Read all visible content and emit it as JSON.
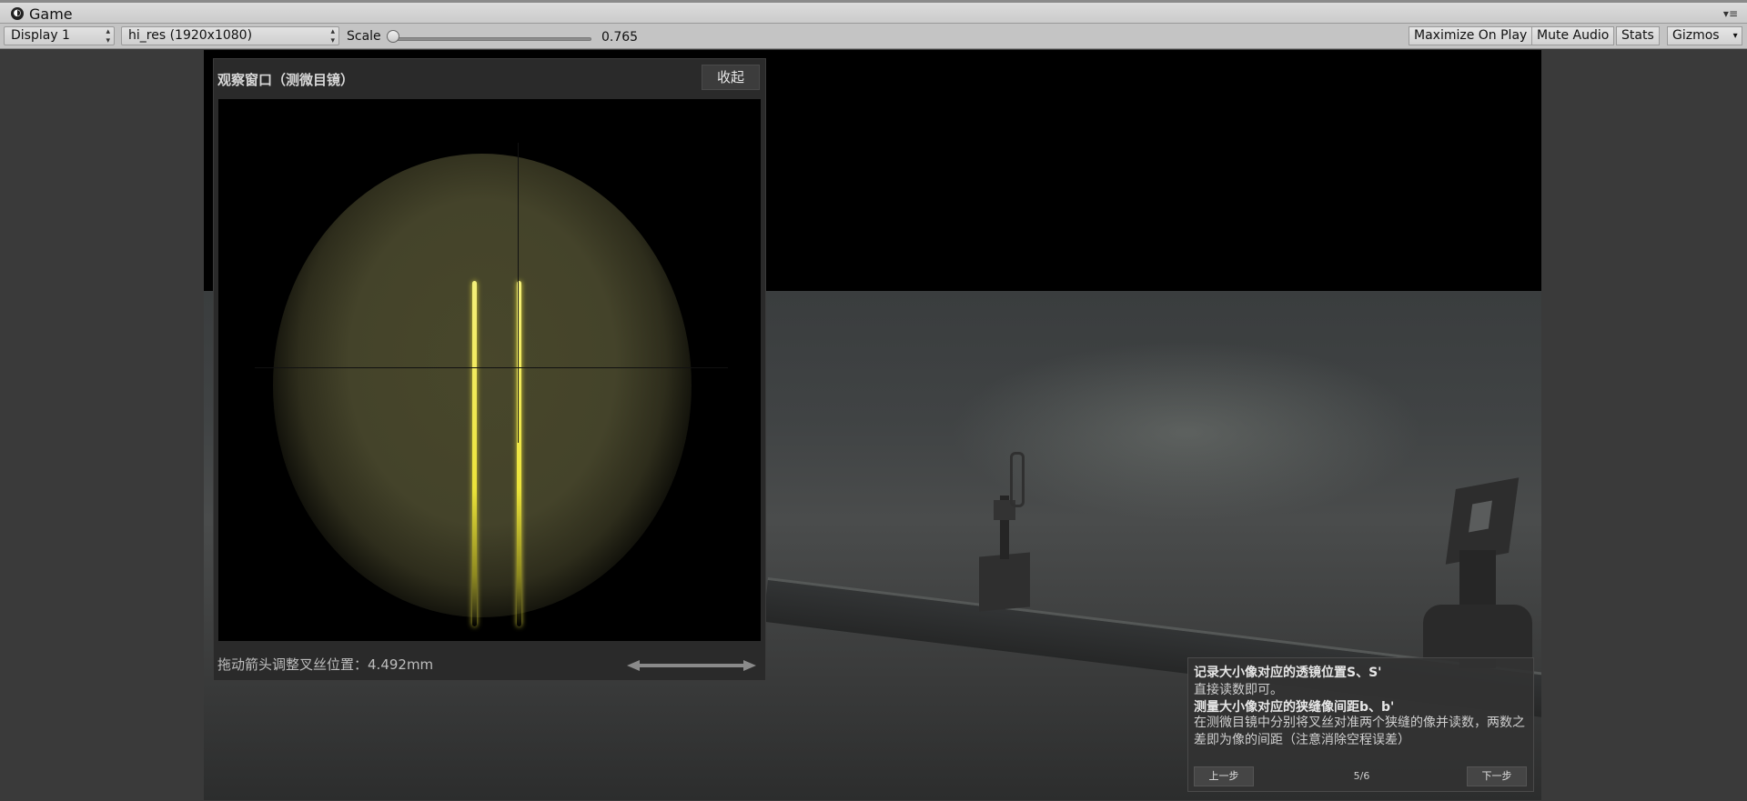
{
  "window": {
    "title": "Game"
  },
  "toolbar": {
    "display_select": "Display 1",
    "resolution_select": "hi_res (1920x1080)",
    "scale_label": "Scale",
    "scale_value": "0.765",
    "buttons": [
      "Maximize On Play",
      "Mute Audio",
      "Stats",
      "Gizmos"
    ]
  },
  "observation_window": {
    "title": "观察窗口（测微目镜）",
    "collapse_label": "收起",
    "status_text": "拖动箭头调整叉丝位置：4.492mm"
  },
  "instructions": {
    "heading1": "记录大小像对应的透镜位置S、S'",
    "text1": "直接读数即可。",
    "heading2": "测量大小像对应的狭缝像间距b、b'",
    "text2": "在测微目镜中分别将叉丝对准两个狭缝的像并读数，两数之差即为像的间距（注意消除空程误差）",
    "prev_label": "上一步",
    "page": "5/6",
    "next_label": "下一步"
  }
}
